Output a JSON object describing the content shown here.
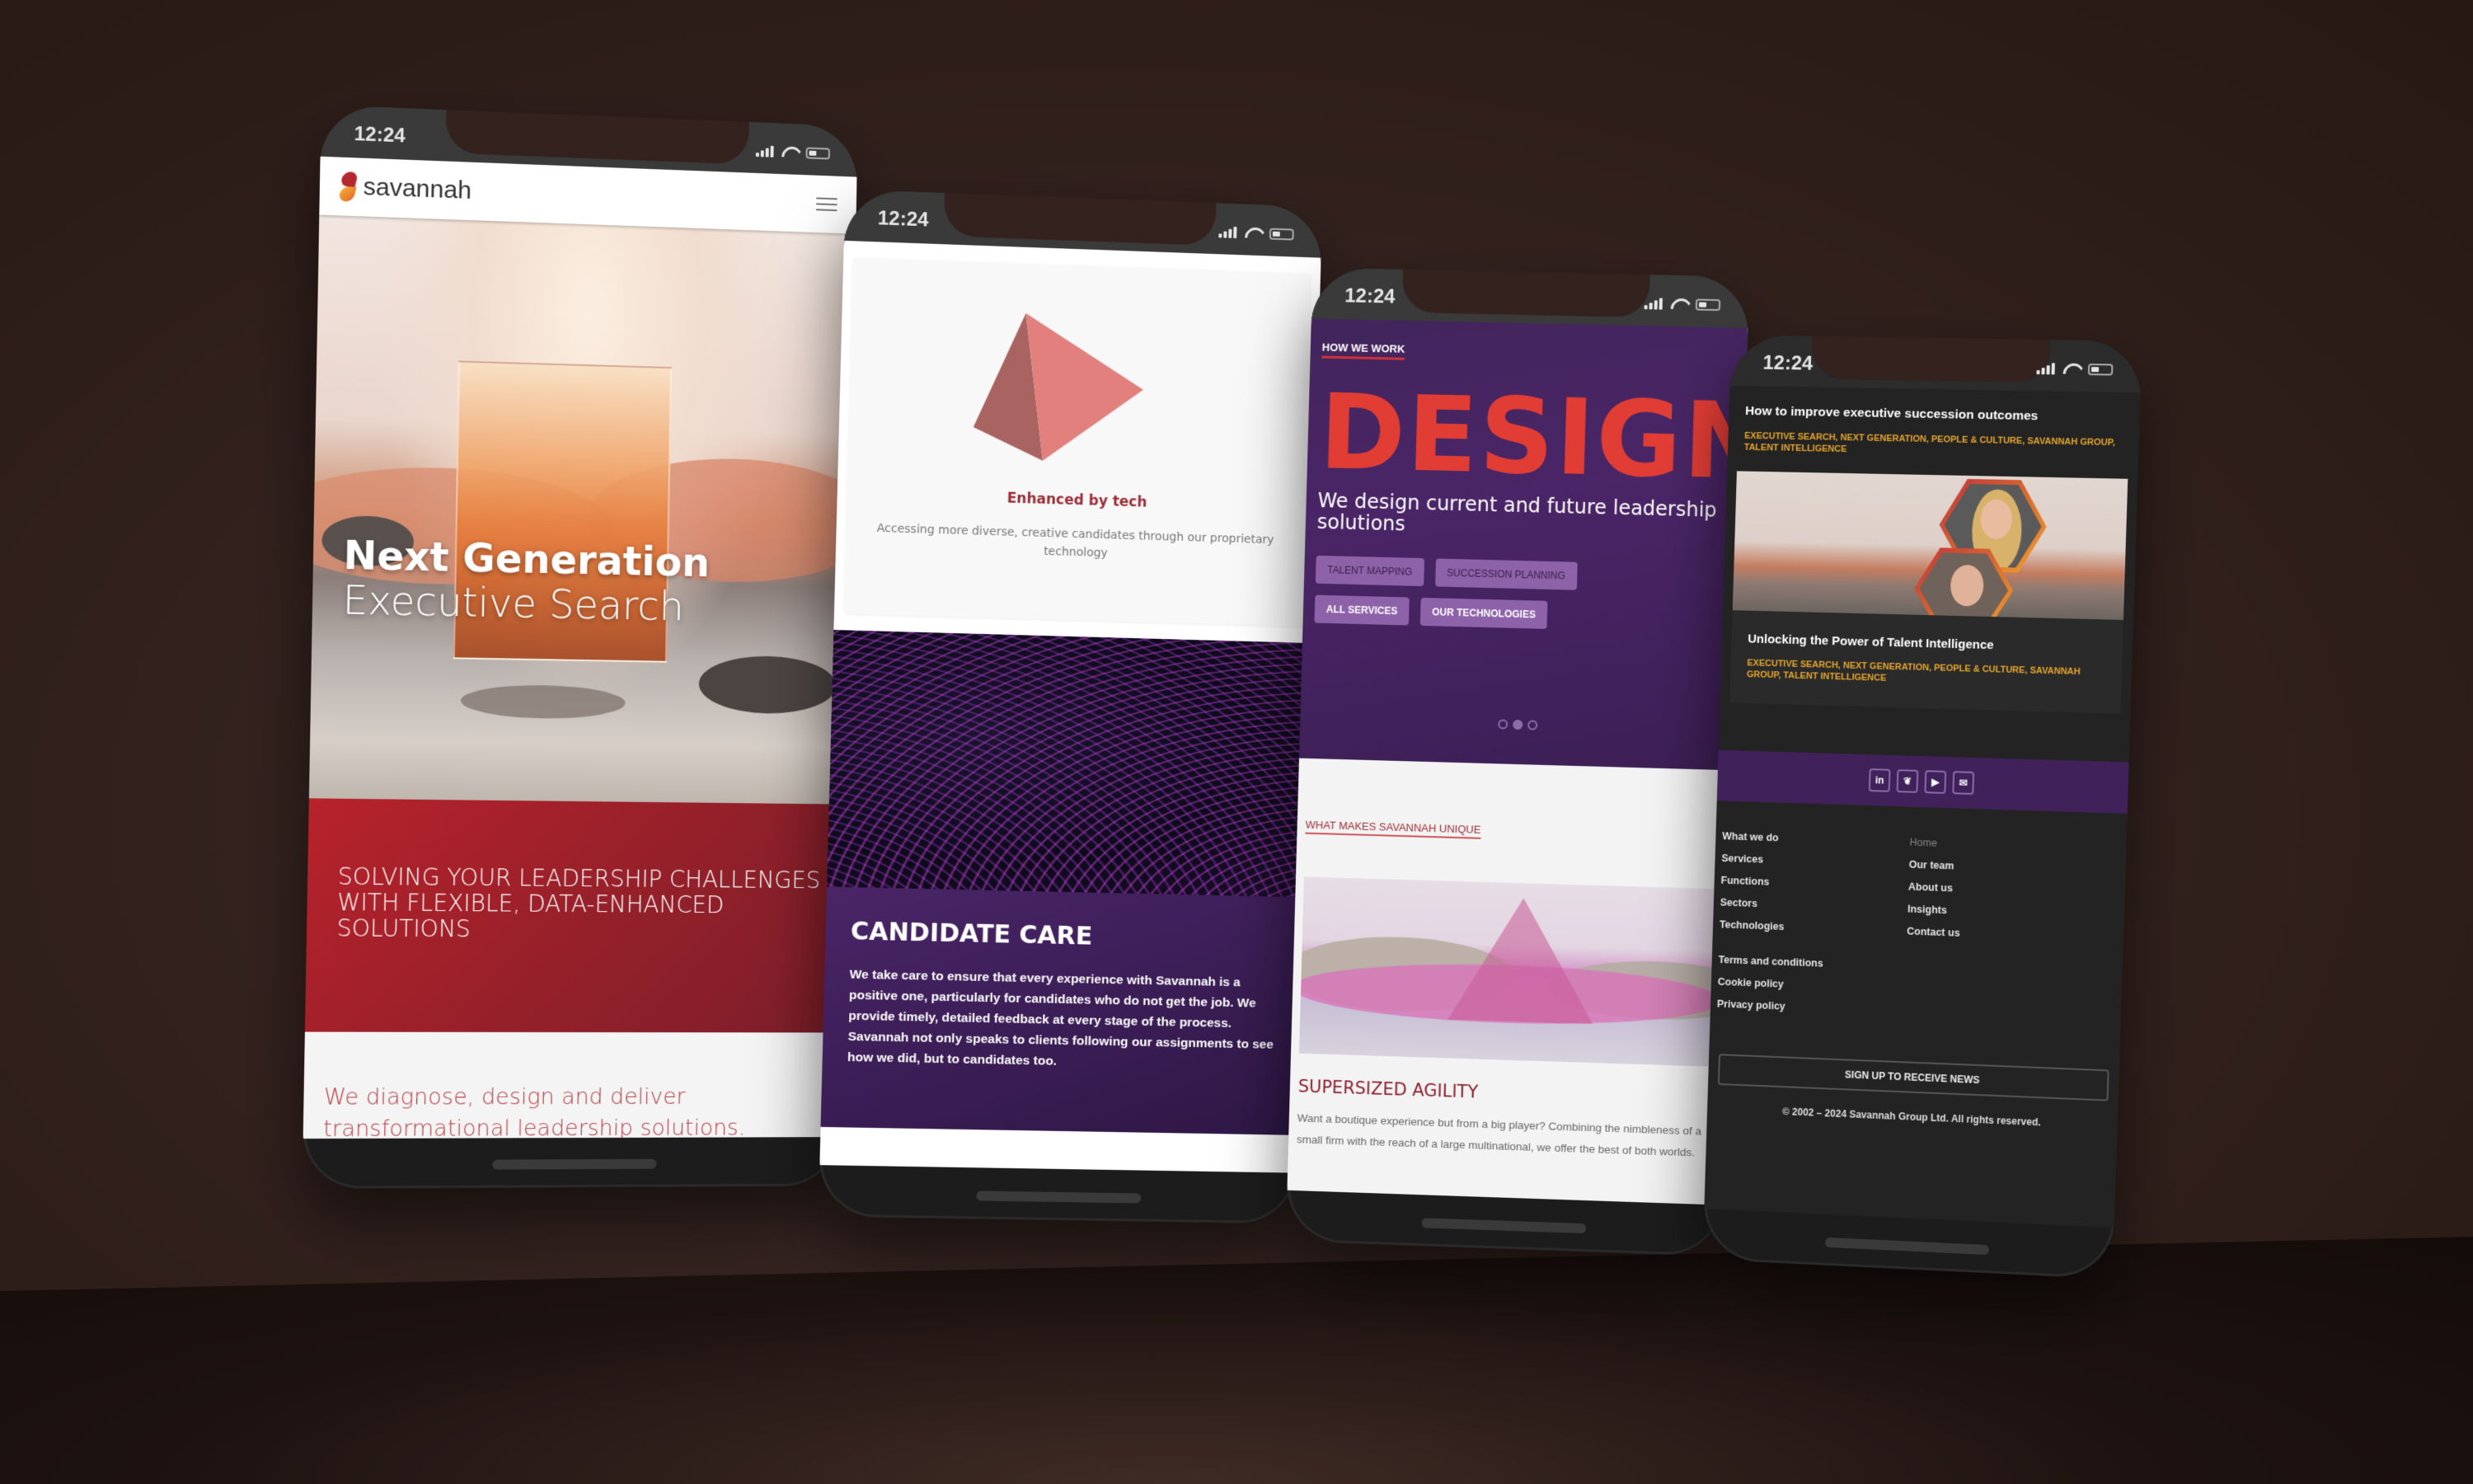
{
  "status_bar": {
    "time": "12:24"
  },
  "phone1": {
    "brand": "savannah",
    "hero": {
      "line1": "Next Generation",
      "line2": "Executive Search"
    },
    "banner": "SOLVING YOUR LEADERSHIP CHALLENGES WITH FLEXIBLE, DATA-ENHANCED SOLUTIONS",
    "tagline": "We diagnose, design and deliver transformational leadership solutions."
  },
  "phone2": {
    "card": {
      "title": "Enhanced by tech",
      "description": "Accessing more diverse, creative candidates through our proprietary technology"
    },
    "candidate_care": {
      "title": "CANDIDATE CARE",
      "body": "We take care to ensure that every experience with Savannah is a positive one, particularly for candidates who do not get the job.  We provide timely, detailed feedback at every stage of the process. Savannah not only speaks to clients following our assignments to see how we did, but to candidates too."
    }
  },
  "phone3": {
    "eyebrow": "HOW WE WORK",
    "headline": "DESIGN",
    "subheadline": "We design current and future leadership solutions",
    "chips": [
      {
        "label": "TALENT MAPPING",
        "bold": false
      },
      {
        "label": "SUCCESSION PLANNING",
        "bold": false
      },
      {
        "label": "ALL SERVICES",
        "bold": true
      },
      {
        "label": "OUR TECHNOLOGIES",
        "bold": true
      }
    ],
    "carousel": {
      "total": 3,
      "active": 2
    },
    "unique": {
      "eyebrow": "WHAT MAKES SAVANNAH UNIQUE",
      "title": "SUPERSIZED AGILITY",
      "description": "Want a boutique experience but from a big player? Combining the nimbleness of a small firm with the reach of a large multinational, we offer the best of both worlds."
    }
  },
  "phone4": {
    "article1": {
      "title": "How to improve executive succession outcomes",
      "tags": "EXECUTIVE SEARCH, NEXT GENERATION, PEOPLE & CULTURE, SAVANNAH GROUP, TALENT INTELLIGENCE"
    },
    "article2": {
      "title": "Unlocking the Power of Talent Intelligence",
      "tags": "EXECUTIVE SEARCH, NEXT GENERATION, PEOPLE & CULTURE, SAVANNAH GROUP, TALENT INTELLIGENCE"
    },
    "social": [
      {
        "name": "linkedin-icon",
        "glyph": "in"
      },
      {
        "name": "twitter-icon",
        "glyph": "❦"
      },
      {
        "name": "youtube-icon",
        "glyph": "▶"
      },
      {
        "name": "email-icon",
        "glyph": "✉"
      }
    ],
    "footer_col1": [
      "What we do",
      "Services",
      "Functions",
      "Sectors",
      "Technologies"
    ],
    "footer_col2": [
      "Home",
      "Our team",
      "About us",
      "Insights",
      "Contact us"
    ],
    "legal": [
      "Terms and conditions",
      "Cookie policy",
      "Privacy policy"
    ],
    "signup_label": "SIGN UP TO RECEIVE NEWS",
    "copyright": "© 2002 – 2024 Savannah Group Ltd. All rights reserved."
  },
  "colors": {
    "brand_red": "#b8222b",
    "brand_purple": "#4a2567",
    "accent_orange": "#e5a52c",
    "design_red": "#e23d35"
  }
}
